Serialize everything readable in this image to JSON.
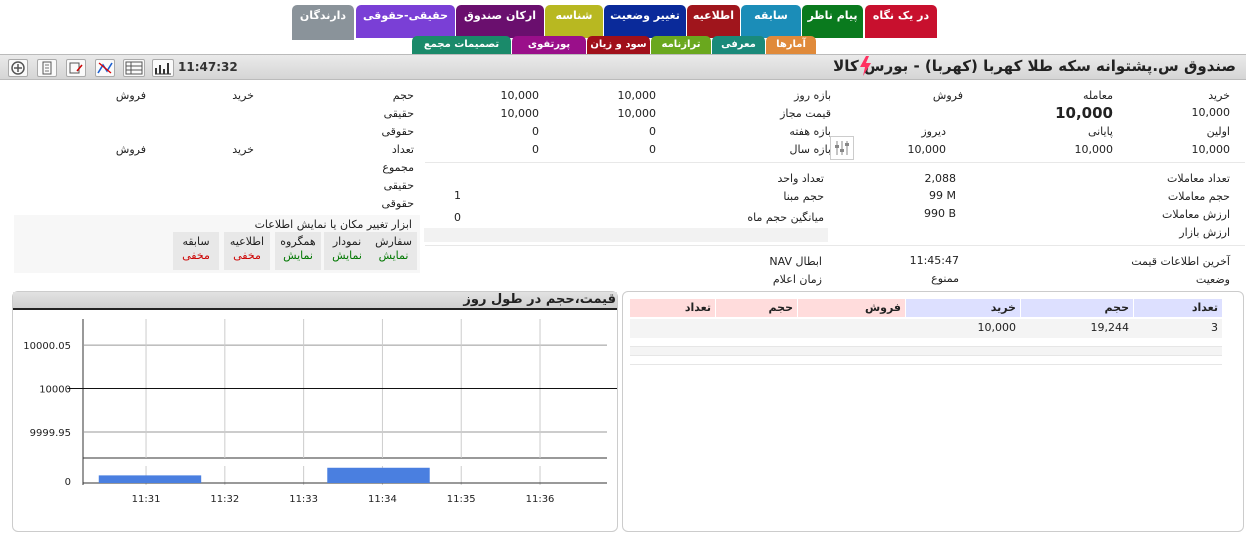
{
  "tabs_row1": [
    {
      "label": "در یک نگاه",
      "color": "#c8102e"
    },
    {
      "label": "پیام ناظر",
      "color": "#0a7a1e"
    },
    {
      "label": "سابقه",
      "color": "#1b8db8"
    },
    {
      "label": "اطلاعیه",
      "color": "#a0151c"
    },
    {
      "label": "تغییر وضعیت",
      "color": "#0a2a9a"
    },
    {
      "label": "شناسه",
      "color": "#b8b821"
    },
    {
      "label": "ارکان صندوق",
      "color": "#6a0f6e"
    },
    {
      "label": "حقیقی-حقوقی",
      "color": "#7a3fd6"
    },
    {
      "label": "دارندگان",
      "color": "#8a939a"
    }
  ],
  "tabs_row2": [
    {
      "label": "آمارها",
      "color": "#e08a3a"
    },
    {
      "label": "معرفی",
      "color": "#1a8a7a"
    },
    {
      "label": "ترازنامه",
      "color": "#6aa81e"
    },
    {
      "label": "سود و زیان",
      "color": "#a0101a"
    },
    {
      "label": "پورتفوی",
      "color": "#9a0f8a"
    },
    {
      "label": "تصمیمات مجمع",
      "color": "#1a8a6a"
    }
  ],
  "header": {
    "time": "11:47:32",
    "title": "صندوق س.پشتوانه سکه طلا کهربا (کهربا) - بورس کالا",
    "toolbar_icons": [
      "add-icon",
      "document-icon",
      "edit-icon",
      "network-icon",
      "list-icon",
      "bar-chart-icon"
    ]
  },
  "price": {
    "buy_label": "خرید",
    "buy_value": "10,000",
    "trade_label": "معامله",
    "trade_value": "10,000",
    "sell_label": "فروش",
    "first_label": "اولین",
    "first_value": "10,000",
    "last_label": "پایانی",
    "last_value": "10,000",
    "yesterday_label": "دیروز",
    "yesterday_value": "10,000"
  },
  "ranges": {
    "day_label": "بازه روز",
    "day_low": "10,000",
    "day_high": "10,000",
    "allowed_label": "قیمت مجاز",
    "allowed_low": "10,000",
    "allowed_high": "10,000",
    "week_label": "بازه هفته",
    "week_low": "0",
    "week_high": "0",
    "year_label": "بازه سال",
    "year_low": "0",
    "year_high": "0"
  },
  "client_types": {
    "volume_label": "حجم",
    "buy_label": "خرید",
    "sell_label": "فروش",
    "real_label": "حقیقی",
    "legal_label": "حقوقی",
    "count_label": "تعداد",
    "count_buy_label": "خرید",
    "count_sell_label": "فروش",
    "total_label": "مجموع",
    "real2_label": "حقیقی",
    "legal2_label": "حقوقی"
  },
  "stats": {
    "trade_count_label": "تعداد معاملات",
    "trade_count": "2,088",
    "trade_volume_label": "حجم معاملات",
    "trade_volume": "99 M",
    "trade_value_label": "ارزش معاملات",
    "trade_value": "990 B",
    "market_value_label": "ارزش بازار",
    "unit_count_label": "تعداد واحد",
    "base_volume_label": "حجم مبنا",
    "base_volume": "1",
    "avg_month_label": "میانگین حجم ماه",
    "avg_month": "0"
  },
  "info": {
    "last_price_label": "آخرین اطلاعات قیمت",
    "last_price_time": "11:45:47",
    "status_label": "وضعیت",
    "status_value": "ممنوع",
    "nav_label": "NAV ابطال",
    "announce_label": "زمان اعلام"
  },
  "toggle_tool": {
    "caption": "ابزار تغییر مکان یا نمایش اطلاعات",
    "items": [
      {
        "name": "سفارش",
        "state": "نمایش",
        "on": true
      },
      {
        "name": "نمودار",
        "state": "نمایش",
        "on": true
      },
      {
        "name": "همگروه",
        "state": "نمایش",
        "on": true
      },
      {
        "name": "اطلاعیه",
        "state": "مخفی",
        "on": false
      },
      {
        "name": "سابقه",
        "state": "مخفی",
        "on": false
      }
    ]
  },
  "orders": {
    "headers": {
      "count_buy": "تعداد",
      "volume_buy": "حجم",
      "price_buy": "خرید",
      "price_sell": "فروش",
      "volume_sell": "حجم",
      "count_sell": "تعداد"
    },
    "header_colors": {
      "buy": "#dde0ff",
      "sell": "#ffdcdc"
    },
    "rows": [
      {
        "count_buy": "3",
        "volume_buy": "19,244",
        "price_buy": "10,000",
        "price_sell": "",
        "volume_sell": "",
        "count_sell": ""
      }
    ]
  },
  "chart_data": {
    "type": "line",
    "title": "قیمت،حجم در طول روز",
    "y_ticks": [
      "10000.05",
      "10000",
      "9999.95"
    ],
    "ylim": [
      9999.92,
      10000.08
    ],
    "x_ticks": [
      "11:31",
      "11:32",
      "11:33",
      "11:34",
      "11:35",
      "11:36"
    ],
    "price_series": {
      "x": [
        "11:30",
        "11:37"
      ],
      "values": [
        10000,
        10000
      ]
    },
    "volume": {
      "y_tick": "0",
      "bars": [
        {
          "start": "11:30.4",
          "end": "11:31.7",
          "value": 1
        },
        {
          "start": "11:33.3",
          "end": "11:34.6",
          "value": 2
        }
      ]
    },
    "grid": true
  }
}
